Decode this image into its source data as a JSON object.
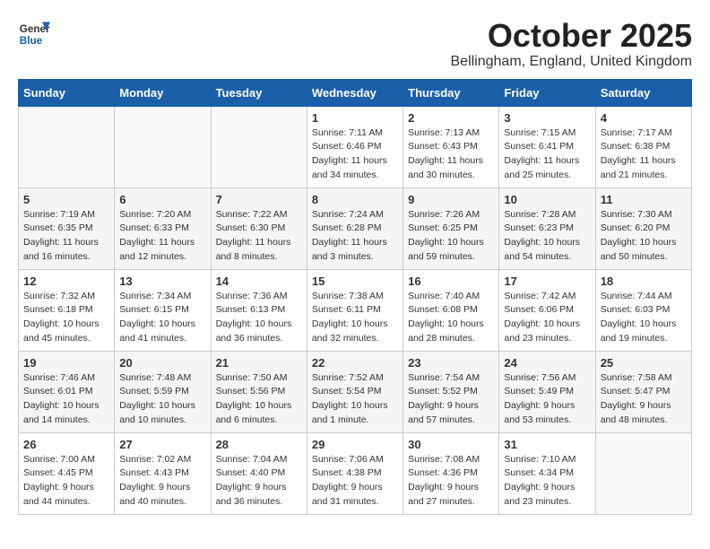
{
  "logo": {
    "general": "General",
    "blue": "Blue"
  },
  "title": "October 2025",
  "subtitle": "Bellingham, England, United Kingdom",
  "days_header": [
    "Sunday",
    "Monday",
    "Tuesday",
    "Wednesday",
    "Thursday",
    "Friday",
    "Saturday"
  ],
  "weeks": [
    [
      {
        "day": "",
        "info": ""
      },
      {
        "day": "",
        "info": ""
      },
      {
        "day": "",
        "info": ""
      },
      {
        "day": "1",
        "info": "Sunrise: 7:11 AM\nSunset: 6:46 PM\nDaylight: 11 hours\nand 34 minutes."
      },
      {
        "day": "2",
        "info": "Sunrise: 7:13 AM\nSunset: 6:43 PM\nDaylight: 11 hours\nand 30 minutes."
      },
      {
        "day": "3",
        "info": "Sunrise: 7:15 AM\nSunset: 6:41 PM\nDaylight: 11 hours\nand 25 minutes."
      },
      {
        "day": "4",
        "info": "Sunrise: 7:17 AM\nSunset: 6:38 PM\nDaylight: 11 hours\nand 21 minutes."
      }
    ],
    [
      {
        "day": "5",
        "info": "Sunrise: 7:19 AM\nSunset: 6:35 PM\nDaylight: 11 hours\nand 16 minutes."
      },
      {
        "day": "6",
        "info": "Sunrise: 7:20 AM\nSunset: 6:33 PM\nDaylight: 11 hours\nand 12 minutes."
      },
      {
        "day": "7",
        "info": "Sunrise: 7:22 AM\nSunset: 6:30 PM\nDaylight: 11 hours\nand 8 minutes."
      },
      {
        "day": "8",
        "info": "Sunrise: 7:24 AM\nSunset: 6:28 PM\nDaylight: 11 hours\nand 3 minutes."
      },
      {
        "day": "9",
        "info": "Sunrise: 7:26 AM\nSunset: 6:25 PM\nDaylight: 10 hours\nand 59 minutes."
      },
      {
        "day": "10",
        "info": "Sunrise: 7:28 AM\nSunset: 6:23 PM\nDaylight: 10 hours\nand 54 minutes."
      },
      {
        "day": "11",
        "info": "Sunrise: 7:30 AM\nSunset: 6:20 PM\nDaylight: 10 hours\nand 50 minutes."
      }
    ],
    [
      {
        "day": "12",
        "info": "Sunrise: 7:32 AM\nSunset: 6:18 PM\nDaylight: 10 hours\nand 45 minutes."
      },
      {
        "day": "13",
        "info": "Sunrise: 7:34 AM\nSunset: 6:15 PM\nDaylight: 10 hours\nand 41 minutes."
      },
      {
        "day": "14",
        "info": "Sunrise: 7:36 AM\nSunset: 6:13 PM\nDaylight: 10 hours\nand 36 minutes."
      },
      {
        "day": "15",
        "info": "Sunrise: 7:38 AM\nSunset: 6:11 PM\nDaylight: 10 hours\nand 32 minutes."
      },
      {
        "day": "16",
        "info": "Sunrise: 7:40 AM\nSunset: 6:08 PM\nDaylight: 10 hours\nand 28 minutes."
      },
      {
        "day": "17",
        "info": "Sunrise: 7:42 AM\nSunset: 6:06 PM\nDaylight: 10 hours\nand 23 minutes."
      },
      {
        "day": "18",
        "info": "Sunrise: 7:44 AM\nSunset: 6:03 PM\nDaylight: 10 hours\nand 19 minutes."
      }
    ],
    [
      {
        "day": "19",
        "info": "Sunrise: 7:46 AM\nSunset: 6:01 PM\nDaylight: 10 hours\nand 14 minutes."
      },
      {
        "day": "20",
        "info": "Sunrise: 7:48 AM\nSunset: 5:59 PM\nDaylight: 10 hours\nand 10 minutes."
      },
      {
        "day": "21",
        "info": "Sunrise: 7:50 AM\nSunset: 5:56 PM\nDaylight: 10 hours\nand 6 minutes."
      },
      {
        "day": "22",
        "info": "Sunrise: 7:52 AM\nSunset: 5:54 PM\nDaylight: 10 hours\nand 1 minute."
      },
      {
        "day": "23",
        "info": "Sunrise: 7:54 AM\nSunset: 5:52 PM\nDaylight: 9 hours\nand 57 minutes."
      },
      {
        "day": "24",
        "info": "Sunrise: 7:56 AM\nSunset: 5:49 PM\nDaylight: 9 hours\nand 53 minutes."
      },
      {
        "day": "25",
        "info": "Sunrise: 7:58 AM\nSunset: 5:47 PM\nDaylight: 9 hours\nand 48 minutes."
      }
    ],
    [
      {
        "day": "26",
        "info": "Sunrise: 7:00 AM\nSunset: 4:45 PM\nDaylight: 9 hours\nand 44 minutes."
      },
      {
        "day": "27",
        "info": "Sunrise: 7:02 AM\nSunset: 4:43 PM\nDaylight: 9 hours\nand 40 minutes."
      },
      {
        "day": "28",
        "info": "Sunrise: 7:04 AM\nSunset: 4:40 PM\nDaylight: 9 hours\nand 36 minutes."
      },
      {
        "day": "29",
        "info": "Sunrise: 7:06 AM\nSunset: 4:38 PM\nDaylight: 9 hours\nand 31 minutes."
      },
      {
        "day": "30",
        "info": "Sunrise: 7:08 AM\nSunset: 4:36 PM\nDaylight: 9 hours\nand 27 minutes."
      },
      {
        "day": "31",
        "info": "Sunrise: 7:10 AM\nSunset: 4:34 PM\nDaylight: 9 hours\nand 23 minutes."
      },
      {
        "day": "",
        "info": ""
      }
    ]
  ]
}
